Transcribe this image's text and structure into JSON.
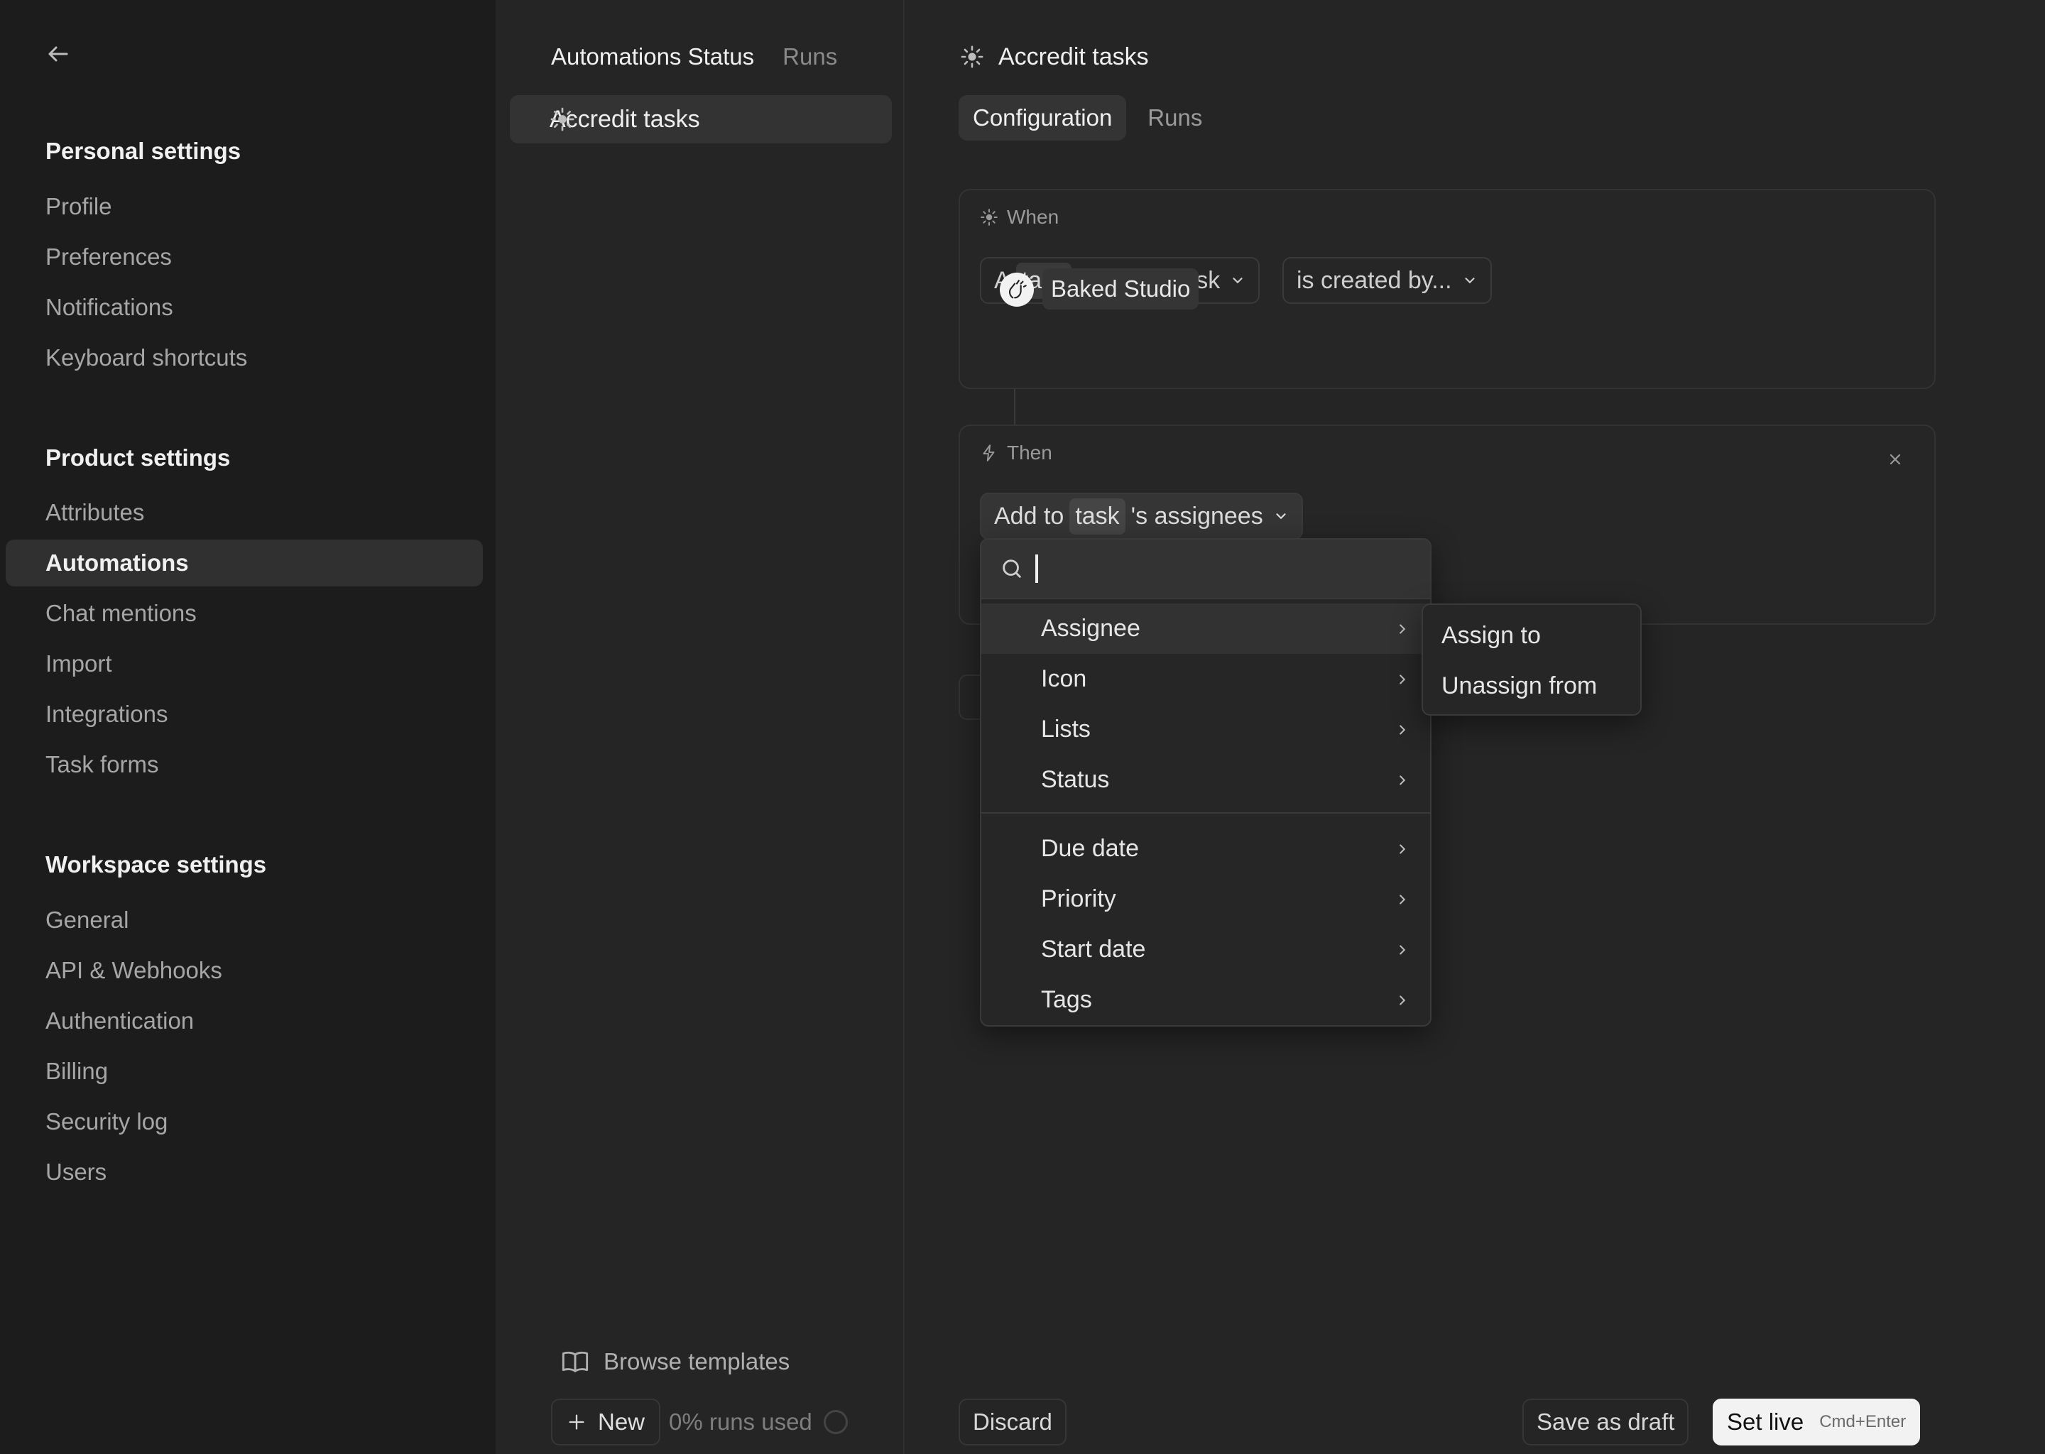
{
  "sidebar": {
    "back_label": "",
    "personal_title": "Personal settings",
    "personal_items": [
      "Profile",
      "Preferences",
      "Notifications",
      "Keyboard shortcuts"
    ],
    "product_title": "Product settings",
    "product_items": [
      "Attributes",
      "Automations",
      "Chat mentions",
      "Import",
      "Integrations",
      "Task forms"
    ],
    "product_active": "Automations",
    "workspace_title": "Workspace settings",
    "workspace_items": [
      "General",
      "API & Webhooks",
      "Authentication",
      "Billing",
      "Security log",
      "Users"
    ]
  },
  "middle": {
    "header_title": "Automations Status",
    "header_runs": "Runs",
    "automation_item": "Accredit tasks",
    "browse_templates": "Browse templates",
    "new_label": "New",
    "runs_used": "0% runs used"
  },
  "editor": {
    "title": "Accredit tasks",
    "tabs": [
      "Configuration",
      "Runs"
    ],
    "active_tab": "Configuration",
    "when": {
      "label": "When",
      "trigger_prefix": "A",
      "trigger_token": "task",
      "trigger_suffix": "'s parent task",
      "condition": "is created by...",
      "creator": "Baked Studio"
    },
    "then": {
      "label": "Then",
      "action_prefix": "Add to",
      "action_token": "task",
      "action_suffix": "'s assignees"
    }
  },
  "dropdown": {
    "search_value": "",
    "group1": [
      "Assignee",
      "Icon",
      "Lists",
      "Status"
    ],
    "group2": [
      "Due date",
      "Priority",
      "Start date",
      "Tags"
    ],
    "hovered": "Assignee"
  },
  "submenu": {
    "items": [
      "Assign to",
      "Unassign from"
    ]
  },
  "actions": {
    "discard": "Discard",
    "save_draft": "Save as draft",
    "set_live": "Set live",
    "set_live_shortcut": "Cmd+Enter"
  },
  "colors": {
    "sidebar_bg": "#1c1c1c",
    "main_bg": "#252525",
    "active_bg": "#303030",
    "primary_button_bg": "#f2f2f2"
  }
}
